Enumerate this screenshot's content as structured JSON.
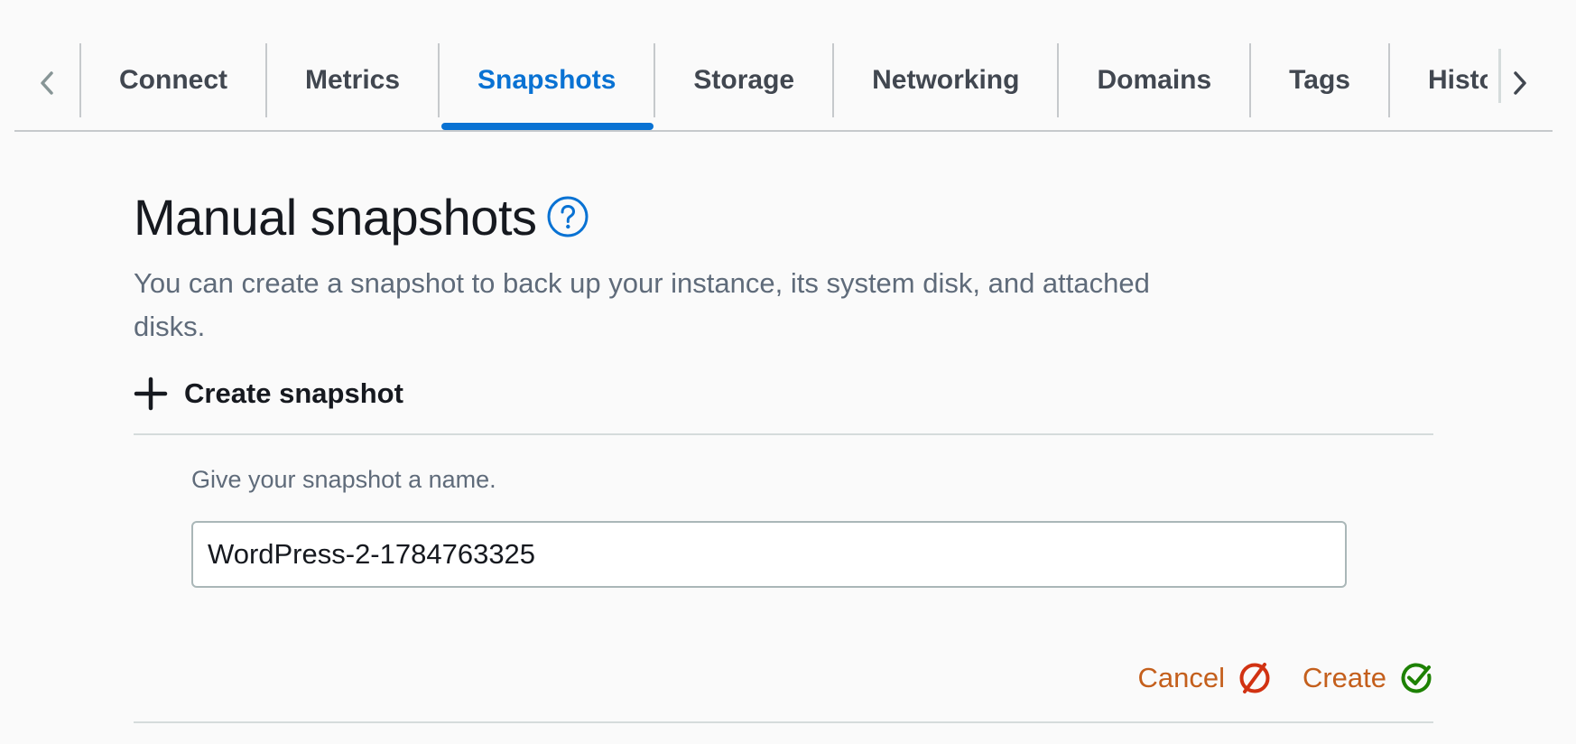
{
  "tabs": {
    "items": [
      {
        "label": "Connect"
      },
      {
        "label": "Metrics"
      },
      {
        "label": "Snapshots"
      },
      {
        "label": "Storage"
      },
      {
        "label": "Networking"
      },
      {
        "label": "Domains"
      },
      {
        "label": "Tags"
      },
      {
        "label": "History"
      }
    ],
    "active": "Snapshots",
    "prev_icon": "chevron-left-icon",
    "next_icon": "chevron-right-icon"
  },
  "main": {
    "title": "Manual snapshots",
    "info_icon": "info-icon",
    "description": "You can create a snapshot to back up your instance, its system disk, and attached disks."
  },
  "create_section": {
    "icon": "plus-icon",
    "title": "Create snapshot",
    "field_label": "Give your snapshot a name.",
    "input_value": "WordPress-2-1784763325",
    "cancel_label": "Cancel",
    "cancel_icon": "cancel-icon",
    "create_label": "Create",
    "create_icon": "check-circle-icon"
  },
  "colors": {
    "accent": "#0972d3",
    "action": "#c45f1c",
    "cancel_icon": "#d13212",
    "create_icon": "#1d8102"
  }
}
